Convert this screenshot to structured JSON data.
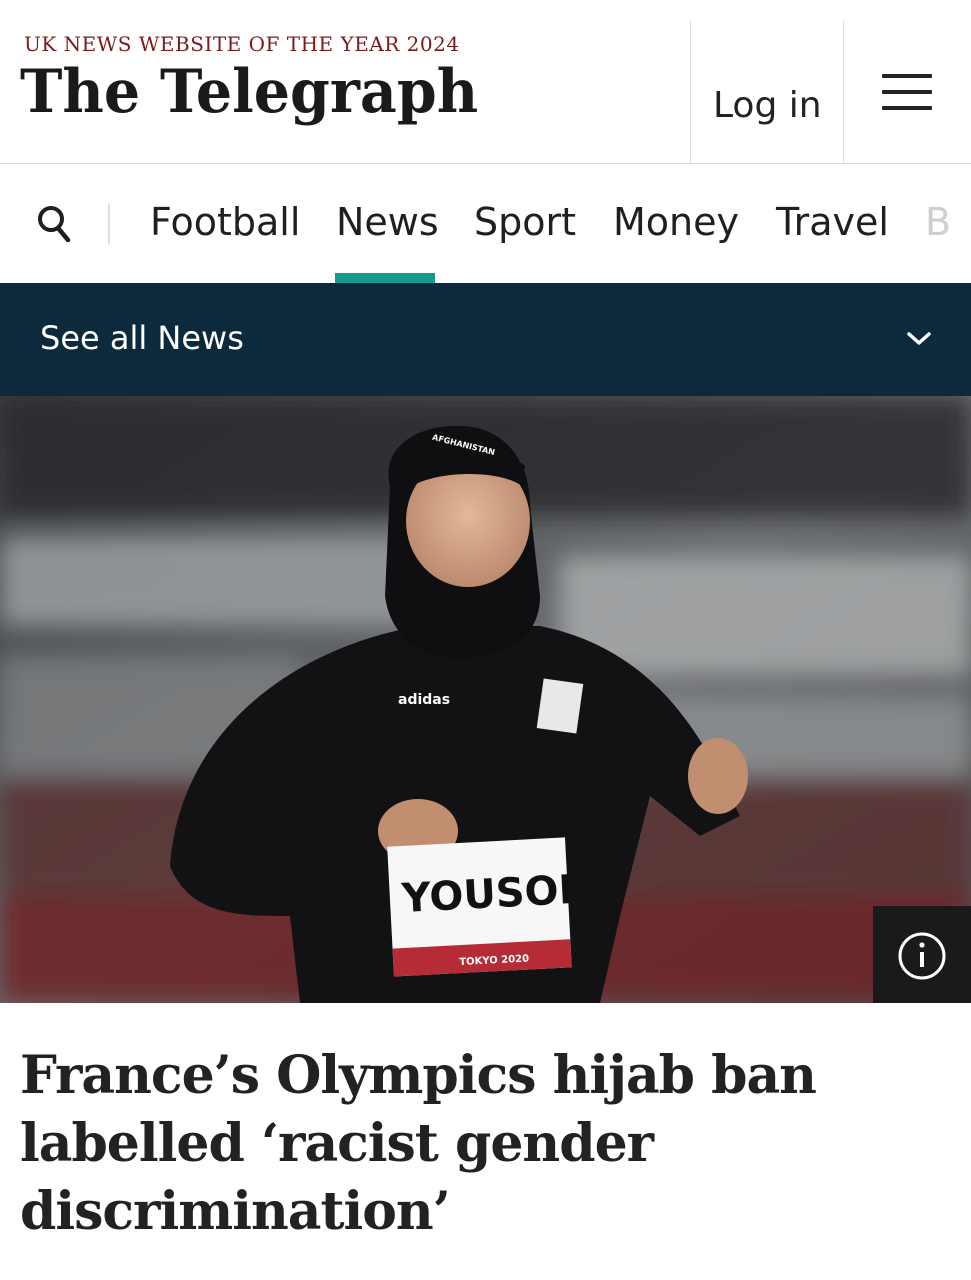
{
  "header": {
    "tagline": "UK NEWS WEBSITE OF THE YEAR 2024",
    "brand": "The Telegraph",
    "login_label": "Log in"
  },
  "nav": {
    "items": [
      "Football",
      "News",
      "Sport",
      "Money",
      "Travel",
      "B"
    ],
    "active": "News"
  },
  "section_bar": {
    "label": "See all News"
  },
  "hero": {
    "bib_name": "YOUSOFI",
    "bib_event": "TOKYO 2020",
    "cap_text": "AFGHANISTAN",
    "shirt_brand": "adidas"
  },
  "article": {
    "headline": "France’s Olympics hijab ban labelled ‘racist gender discrimination’"
  },
  "colors": {
    "accent": "#149b8f",
    "section_bar_bg": "#0c2a3c",
    "tagline": "#7a1b1b"
  },
  "icons": [
    "search-icon",
    "menu-icon",
    "chevron-down-icon",
    "info-icon"
  ]
}
